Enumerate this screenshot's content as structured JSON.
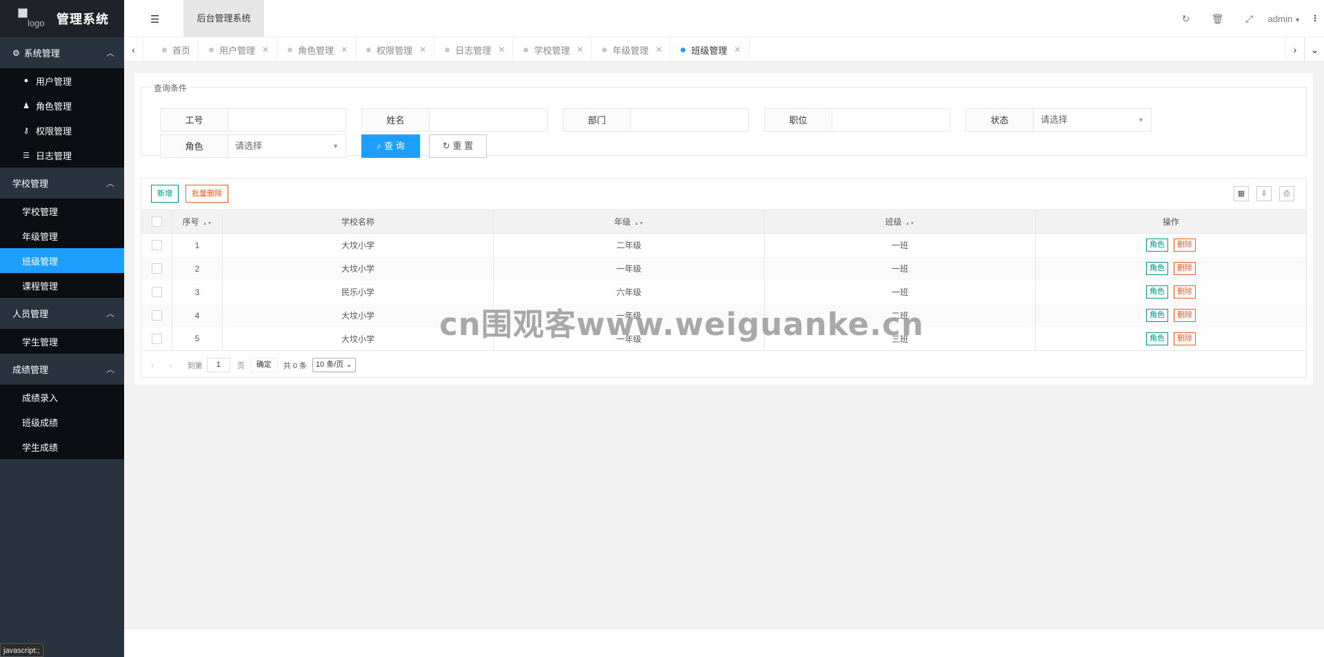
{
  "logo": {
    "alt": "logo",
    "title": "管理系统"
  },
  "header": {
    "system_tab": "后台管理系统",
    "user": "admin"
  },
  "sidebar": {
    "groups": [
      {
        "label": "系统管理",
        "items": [
          "用户管理",
          "角色管理",
          "权限管理",
          "日志管理"
        ]
      },
      {
        "label": "学校管理",
        "items": [
          "学校管理",
          "年级管理",
          "班级管理",
          "课程管理"
        ]
      },
      {
        "label": "人员管理",
        "items": [
          "学生管理"
        ]
      },
      {
        "label": "成绩管理",
        "items": [
          "成绩录入",
          "班级成绩",
          "学生成绩"
        ]
      }
    ]
  },
  "tabs": [
    "首页",
    "用户管理",
    "角色管理",
    "权限管理",
    "日志管理",
    "学校管理",
    "年级管理",
    "班级管理"
  ],
  "query": {
    "legend": "查询条件",
    "fields": [
      "工号",
      "姓名",
      "部门",
      "职位",
      "状态",
      "角色"
    ],
    "select_placeholder": "请选择",
    "search_label": "查 询",
    "reset_label": "重 置"
  },
  "toolbar": {
    "add_label": "新增",
    "batch_delete_label": "批量删除"
  },
  "table": {
    "headers": [
      "序号",
      "学校名称",
      "年级",
      "班级",
      "操作"
    ],
    "rows": [
      {
        "no": "1",
        "school": "大坟小学",
        "grade": "二年级",
        "class": "一班"
      },
      {
        "no": "2",
        "school": "大坟小学",
        "grade": "一年级",
        "class": "一班"
      },
      {
        "no": "3",
        "school": "民乐小学",
        "grade": "六年级",
        "class": "一班"
      },
      {
        "no": "4",
        "school": "大坟小学",
        "grade": "一年级",
        "class": "二班"
      },
      {
        "no": "5",
        "school": "大坟小学",
        "grade": "一年级",
        "class": "三班"
      }
    ],
    "role_label": "角色",
    "delete_label": "删除"
  },
  "pager": {
    "goto": "到第",
    "page": "1",
    "unit": "页",
    "ok": "确定",
    "total": "共 0 条",
    "size": "10 条/页"
  },
  "watermark": "cn围观客www.weiguanke.cn",
  "status_link": "javascript:;"
}
